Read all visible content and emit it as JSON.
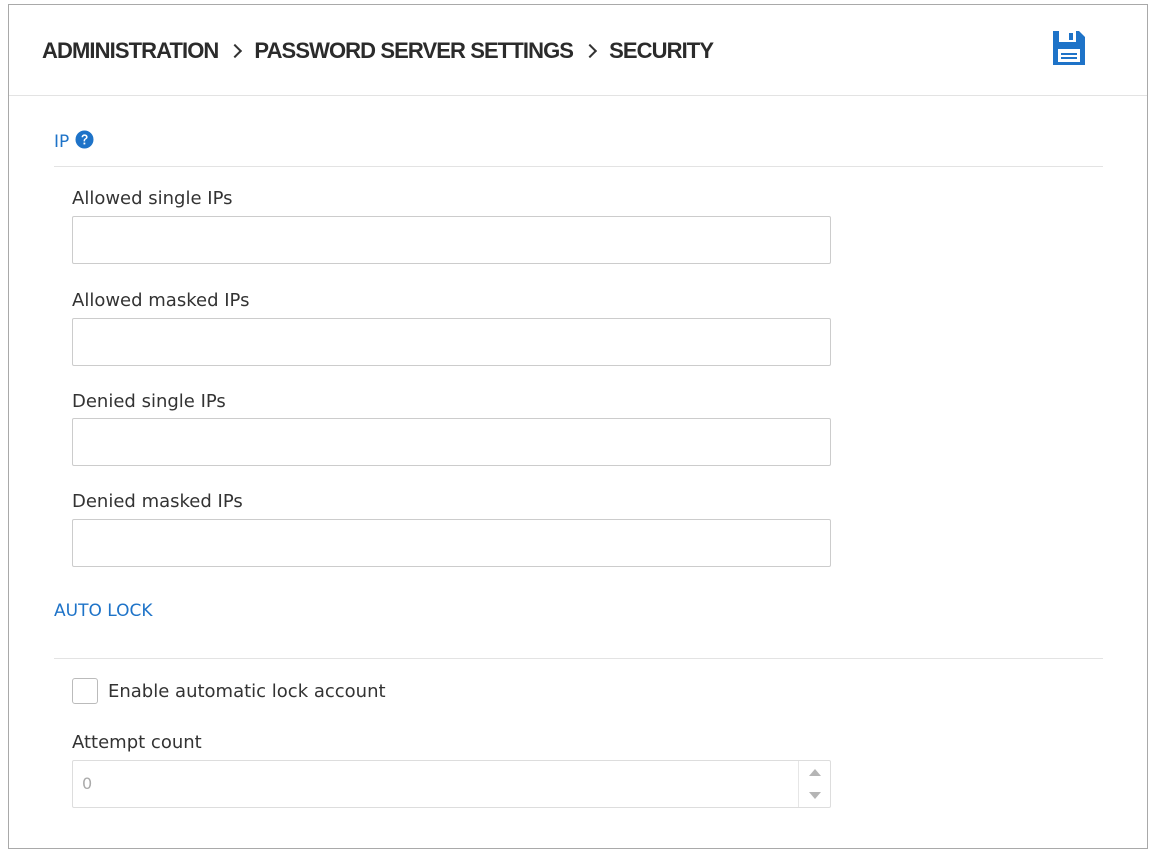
{
  "breadcrumb": {
    "items": [
      "ADMINISTRATION",
      "PASSWORD SERVER SETTINGS",
      "SECURITY"
    ]
  },
  "toolbar": {
    "save_icon": "save-floppy-icon"
  },
  "colors": {
    "accent": "#1e73c8",
    "border": "#cccccc"
  },
  "ip_section": {
    "title": "IP",
    "help_icon": "question-circle-icon",
    "fields": [
      {
        "label": "Allowed single IPs",
        "value": ""
      },
      {
        "label": "Allowed masked IPs",
        "value": ""
      },
      {
        "label": "Denied single IPs",
        "value": ""
      },
      {
        "label": "Denied masked IPs",
        "value": ""
      }
    ]
  },
  "auto_lock": {
    "title": "AUTO LOCK",
    "enable_label": "Enable automatic lock account",
    "enable_checked": false,
    "attempt_label": "Attempt count",
    "attempt_value": "0"
  }
}
